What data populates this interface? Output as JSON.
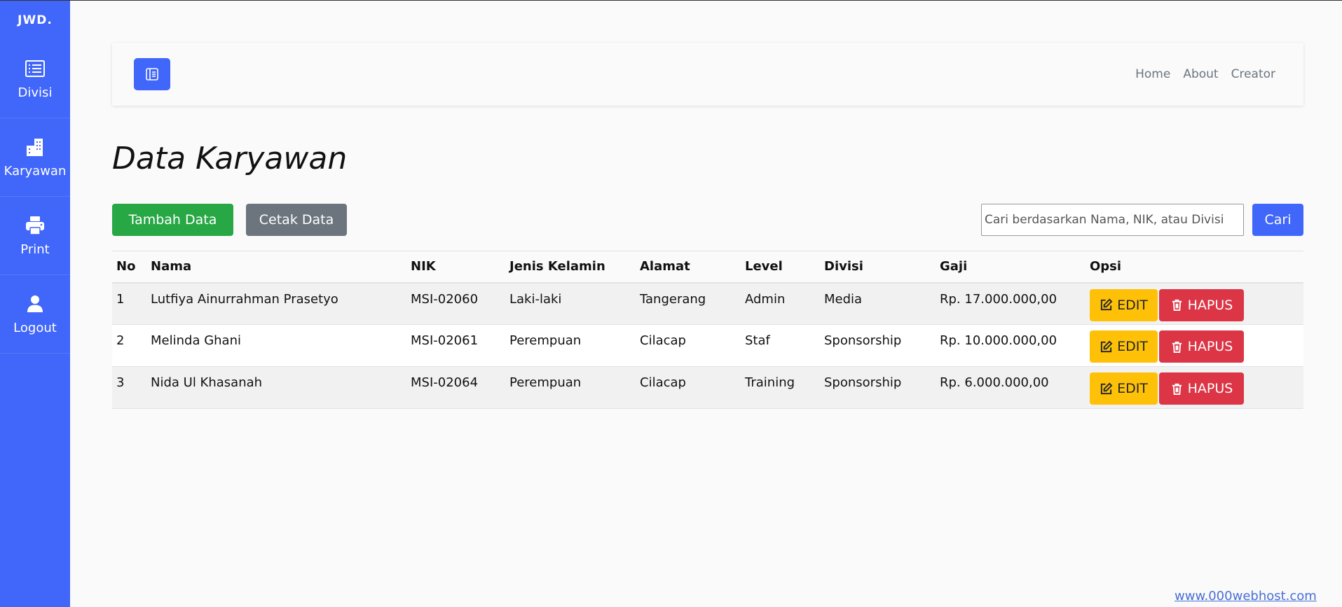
{
  "sidebar": {
    "brand": "JWD.",
    "items": [
      {
        "label": "Divisi",
        "icon": "list-icon"
      },
      {
        "label": "Karyawan",
        "icon": "building-icon"
      },
      {
        "label": "Print",
        "icon": "printer-icon"
      },
      {
        "label": "Logout",
        "icon": "user-icon"
      }
    ]
  },
  "navbar": {
    "links": [
      "Home",
      "About",
      "Creator"
    ]
  },
  "page": {
    "title": "Data Karyawan"
  },
  "actions": {
    "add_label": "Tambah Data",
    "print_label": "Cetak Data",
    "search_placeholder": "Cari berdasarkan Nama, NIK, atau Divisi",
    "search_label": "Cari"
  },
  "table": {
    "headers": [
      "No",
      "Nama",
      "NIK",
      "Jenis Kelamin",
      "Alamat",
      "Level",
      "Divisi",
      "Gaji",
      "Opsi"
    ],
    "edit_label": "EDIT",
    "delete_label": "HAPUS",
    "rows": [
      {
        "no": "1",
        "nama": "Lutfiya Ainurrahman Prasetyo",
        "nik": "MSI-02060",
        "jk": "Laki-laki",
        "alamat": "Tangerang",
        "level": "Admin",
        "divisi": "Media",
        "gaji": "Rp. 17.000.000,00"
      },
      {
        "no": "2",
        "nama": "Melinda Ghani",
        "nik": "MSI-02061",
        "jk": "Perempuan",
        "alamat": "Cilacap",
        "level": "Staf",
        "divisi": "Sponsorship",
        "gaji": "Rp. 10.000.000,00"
      },
      {
        "no": "3",
        "nama": "Nida Ul Khasanah",
        "nik": "MSI-02064",
        "jk": "Perempuan",
        "alamat": "Cilacap",
        "level": "Training",
        "divisi": "Sponsorship",
        "gaji": "Rp. 6.000.000,00"
      }
    ]
  },
  "footer": {
    "link_text": "www.000webhost.com"
  },
  "colors": {
    "primary": "#4066fa",
    "success": "#28a745",
    "secondary": "#6c757d",
    "warning": "#ffc107",
    "danger": "#dc3545"
  }
}
